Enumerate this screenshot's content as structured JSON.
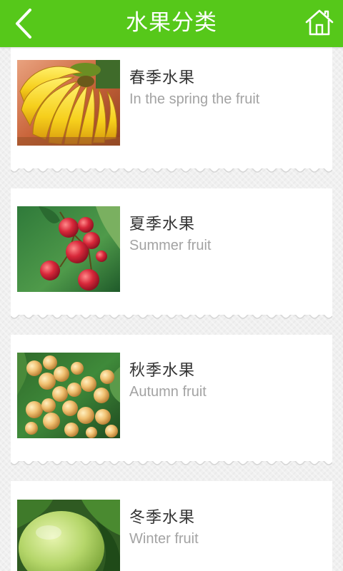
{
  "header": {
    "title": "水果分类",
    "back_icon": "chevron-left-icon",
    "home_icon": "home-icon",
    "color": "#56c81a"
  },
  "categories": [
    {
      "title": "春季水果",
      "subtitle": "In the spring the fruit",
      "image": "bananas"
    },
    {
      "title": "夏季水果",
      "subtitle": "Summer fruit",
      "image": "lychees"
    },
    {
      "title": "秋季水果",
      "subtitle": "Autumn fruit",
      "image": "longans"
    },
    {
      "title": "冬季水果",
      "subtitle": "Winter fruit",
      "image": "pomelo"
    }
  ]
}
